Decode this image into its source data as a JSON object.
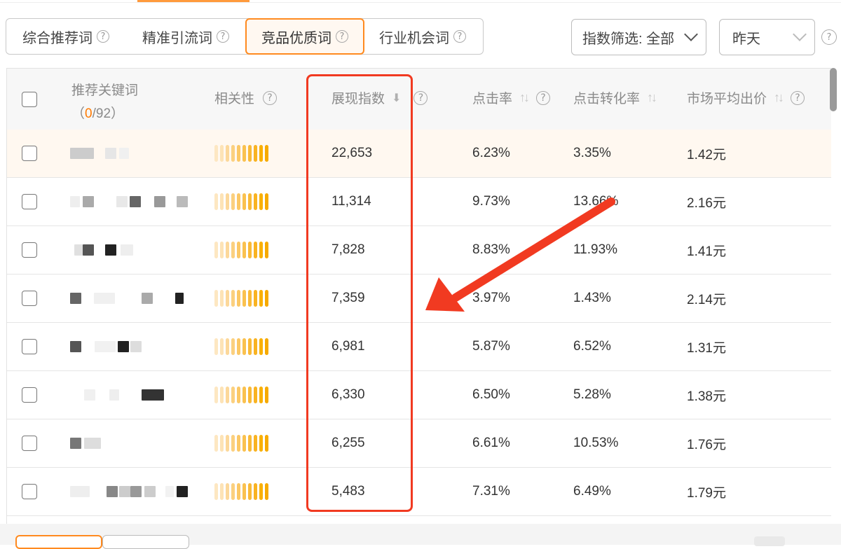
{
  "tabs": [
    {
      "label": "综合推荐词",
      "active": false
    },
    {
      "label": "精准引流词",
      "active": false
    },
    {
      "label": "竞品优质词",
      "active": true
    },
    {
      "label": "行业机会词",
      "active": false
    }
  ],
  "filters": {
    "index_filter": "指数筛选: 全部",
    "date": "昨天"
  },
  "help_glyph": "?",
  "table": {
    "headers": {
      "keyword": "推荐关键词",
      "selected_open": "（",
      "selected_count": "0",
      "selected_total": "/92）",
      "relevance": "相关性",
      "impression_index": "展现指数",
      "ctr": "点击率",
      "cvr": "点击转化率",
      "avg_bid": "市场平均出价"
    },
    "sort_icons": {
      "desc": "⬇",
      "both": "↑↓"
    },
    "rows": [
      {
        "impression": "22,653",
        "ctr": "6.23%",
        "cvr": "3.35%",
        "bid": "1.42元",
        "relevance": 1.0
      },
      {
        "impression": "11,314",
        "ctr": "9.73%",
        "cvr": "13.66%",
        "bid": "2.16元",
        "relevance": 1.0
      },
      {
        "impression": "7,828",
        "ctr": "8.83%",
        "cvr": "11.93%",
        "bid": "1.41元",
        "relevance": 1.0
      },
      {
        "impression": "7,359",
        "ctr": "3.97%",
        "cvr": "1.43%",
        "bid": "2.14元",
        "relevance": 1.0
      },
      {
        "impression": "6,981",
        "ctr": "5.87%",
        "cvr": "6.52%",
        "bid": "1.31元",
        "relevance": 1.0
      },
      {
        "impression": "6,330",
        "ctr": "6.50%",
        "cvr": "5.28%",
        "bid": "1.38元",
        "relevance": 1.0
      },
      {
        "impression": "6,255",
        "ctr": "6.61%",
        "cvr": "10.53%",
        "bid": "1.76元",
        "relevance": 1.0
      },
      {
        "impression": "5,483",
        "ctr": "7.31%",
        "cvr": "6.49%",
        "bid": "1.79元",
        "relevance": 1.0
      }
    ]
  },
  "colors": {
    "accent": "#ff8a1f",
    "count_highlight": "#ff7a00",
    "annotation_red": "#f13a21",
    "relevance_bar": "#f9b000"
  }
}
